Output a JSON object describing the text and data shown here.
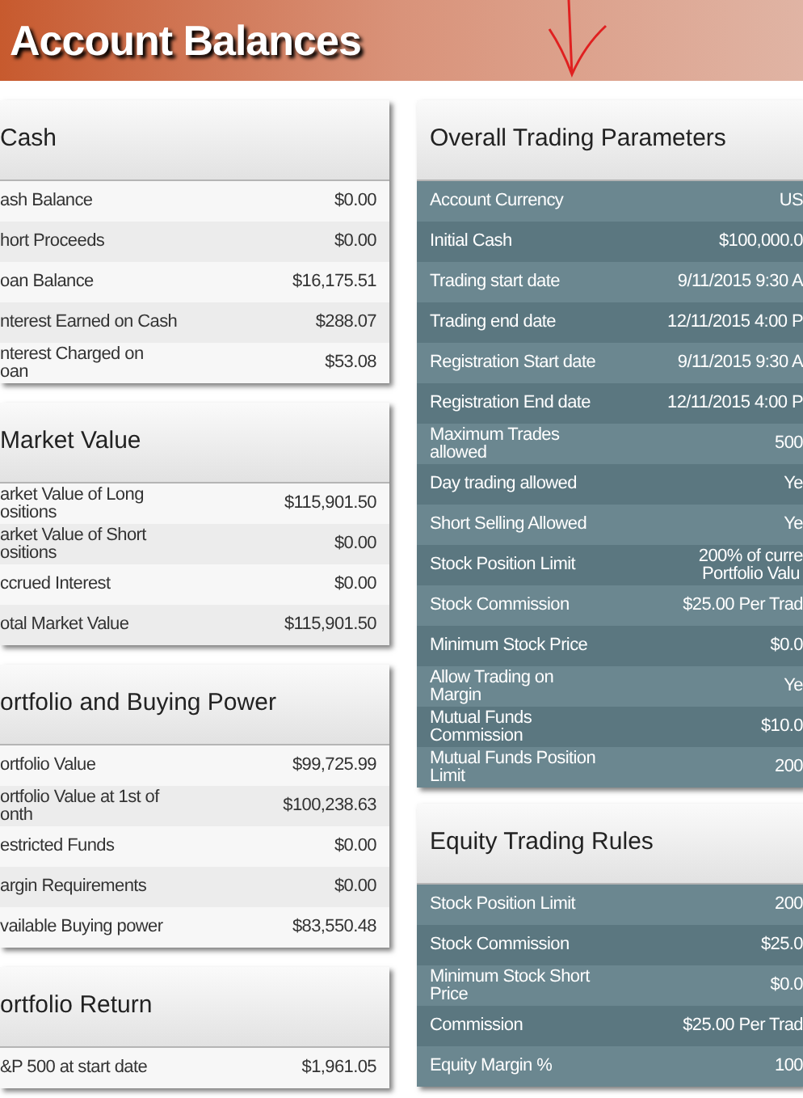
{
  "header": {
    "title": "Account Balances"
  },
  "left_panels": [
    {
      "title": "Cash",
      "rows": [
        {
          "label": "ash Balance",
          "value": "$0.00"
        },
        {
          "label": "hort Proceeds",
          "value": "$0.00"
        },
        {
          "label": "oan Balance",
          "value": "$16,175.51"
        },
        {
          "label": "nterest Earned on Cash",
          "value": "$288.07"
        },
        {
          "label": "nterest Charged on\noan",
          "value": "$53.08"
        }
      ]
    },
    {
      "title": "Market Value",
      "rows": [
        {
          "label": "arket Value of Long\nositions",
          "value": "$115,901.50"
        },
        {
          "label": "arket Value of Short\nositions",
          "value": "$0.00"
        },
        {
          "label": "ccrued Interest",
          "value": "$0.00"
        },
        {
          "label": "otal Market Value",
          "value": "$115,901.50"
        }
      ]
    },
    {
      "title": "ortfolio and Buying Power",
      "rows": [
        {
          "label": "ortfolio Value",
          "value": "$99,725.99"
        },
        {
          "label": "ortfolio Value at 1st of\nonth",
          "value": "$100,238.63"
        },
        {
          "label": "estricted Funds",
          "value": "$0.00"
        },
        {
          "label": "argin Requirements",
          "value": "$0.00"
        },
        {
          "label": "vailable Buying power",
          "value": "$83,550.48"
        }
      ]
    },
    {
      "title": "ortfolio Return",
      "rows": [
        {
          "label": "&P 500 at start date",
          "value": "$1,961.05"
        }
      ]
    }
  ],
  "right_panels": [
    {
      "title": "Overall Trading Parameters",
      "rows": [
        {
          "label": "Account Currency",
          "value": "US"
        },
        {
          "label": "Initial Cash",
          "value": "$100,000.0"
        },
        {
          "label": "Trading start date",
          "value": "9/11/2015 9:30 A"
        },
        {
          "label": "Trading end date",
          "value": "12/11/2015 4:00 P"
        },
        {
          "label": "Registration Start date",
          "value": "9/11/2015 9:30 A"
        },
        {
          "label": "Registration End date",
          "value": "12/11/2015 4:00 P"
        },
        {
          "label": "Maximum Trades\nallowed",
          "value": "500"
        },
        {
          "label": "Day trading allowed",
          "value": "Ye"
        },
        {
          "label": "Short Selling Allowed",
          "value": "Ye"
        },
        {
          "label": "Stock Position Limit",
          "value": "200% of curre\nPortfolio Valu"
        },
        {
          "label": "Stock Commission",
          "value": "$25.00 Per Trad"
        },
        {
          "label": "Minimum Stock Price",
          "value": "$0.0"
        },
        {
          "label": "Allow Trading on\nMargin",
          "value": "Ye"
        },
        {
          "label": "Mutual Funds\nCommission",
          "value": "$10.0"
        },
        {
          "label": "Mutual Funds Position\nLimit",
          "value": "200"
        }
      ]
    },
    {
      "title": "Equity Trading Rules",
      "rows": [
        {
          "label": "Stock Position Limit",
          "value": "200"
        },
        {
          "label": "Stock Commission",
          "value": "$25.0"
        },
        {
          "label": "Minimum Stock Short\nPrice",
          "value": "$0.0"
        },
        {
          "label": "Commission",
          "value": "$25.00 Per Trad"
        },
        {
          "label": "Equity Margin %",
          "value": "100"
        }
      ]
    }
  ]
}
